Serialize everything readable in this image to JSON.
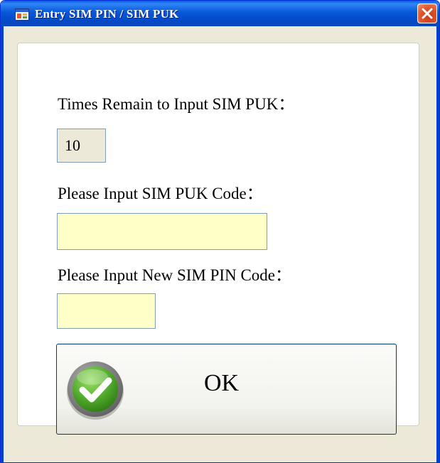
{
  "window": {
    "title": "Entry SIM PIN / SIM PUK",
    "app_icon": "window-app-icon",
    "close_icon": "close-icon"
  },
  "form": {
    "remaining_label": "Times Remain to Input SIM PUK：",
    "remaining_value": "10",
    "puk_label": "Please Input SIM PUK Code：",
    "puk_value": "",
    "new_pin_label": "Please Input New SIM PIN Code：",
    "new_pin_value": ""
  },
  "ok_button": {
    "label": "OK",
    "icon": "checkmark-icon"
  },
  "colors": {
    "titlebar": "#0a5bdf",
    "input_background": "#ffffc8",
    "close_button": "#e0582e",
    "check_green": "#3f9b1c"
  }
}
